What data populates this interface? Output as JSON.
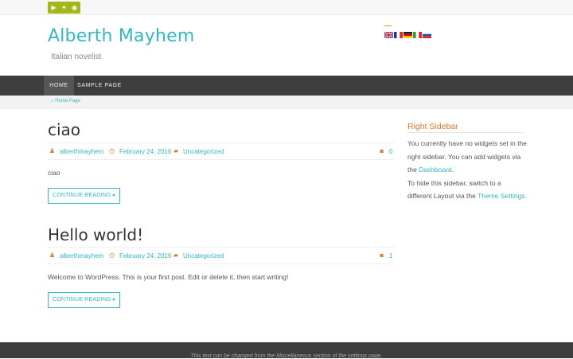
{
  "topbar": {
    "social_icons": [
      {
        "name": "youtube-icon",
        "glyph": "▶"
      },
      {
        "name": "twitter-icon",
        "glyph": "✦"
      },
      {
        "name": "rss-icon",
        "glyph": "◉"
      }
    ]
  },
  "header": {
    "site_title": "Alberth Mayhem",
    "tagline": "Italian novelist",
    "flags": [
      "en",
      "fr",
      "de",
      "it",
      "ru"
    ]
  },
  "nav": {
    "items": [
      {
        "label": "HOME",
        "active": true
      },
      {
        "label": "SAMPLE PAGE",
        "active": false
      }
    ]
  },
  "breadcrumb": {
    "home_label": "Home Page"
  },
  "posts": [
    {
      "title": "ciao",
      "author": "alberthmayhem",
      "date": "February 24, 2016",
      "category": "Uncategorized",
      "comments": "0",
      "excerpt": "ciao",
      "more_label": "CONTINUE READING ▸"
    },
    {
      "title": "Hello world!",
      "author": "alberthmayhem",
      "date": "February 24, 2016",
      "category": "Uncategorized",
      "comments": "1",
      "excerpt": "Welcome to WordPress. This is your first post. Edit or delete it, then start writing!",
      "more_label": "CONTINUE READING ▸"
    }
  ],
  "sidebar": {
    "title": "Right Sidebar",
    "text_1": "You currently have no widgets set in the right sidebar. You can add widgets via the ",
    "link_dashboard": "Dashboard",
    "text_2": ".",
    "text_3": "To hide this sidebar, switch to a different Layout via the ",
    "link_theme": "Theme Settings",
    "text_4": "."
  },
  "footer": {
    "text": "This text can be changed from the Miscellaneous section of the settings page."
  },
  "colors": {
    "accent": "#33b7c4",
    "orange": "#e0762b",
    "nav_bg": "#3d3d3d",
    "social_bg": "#a3b71a"
  }
}
